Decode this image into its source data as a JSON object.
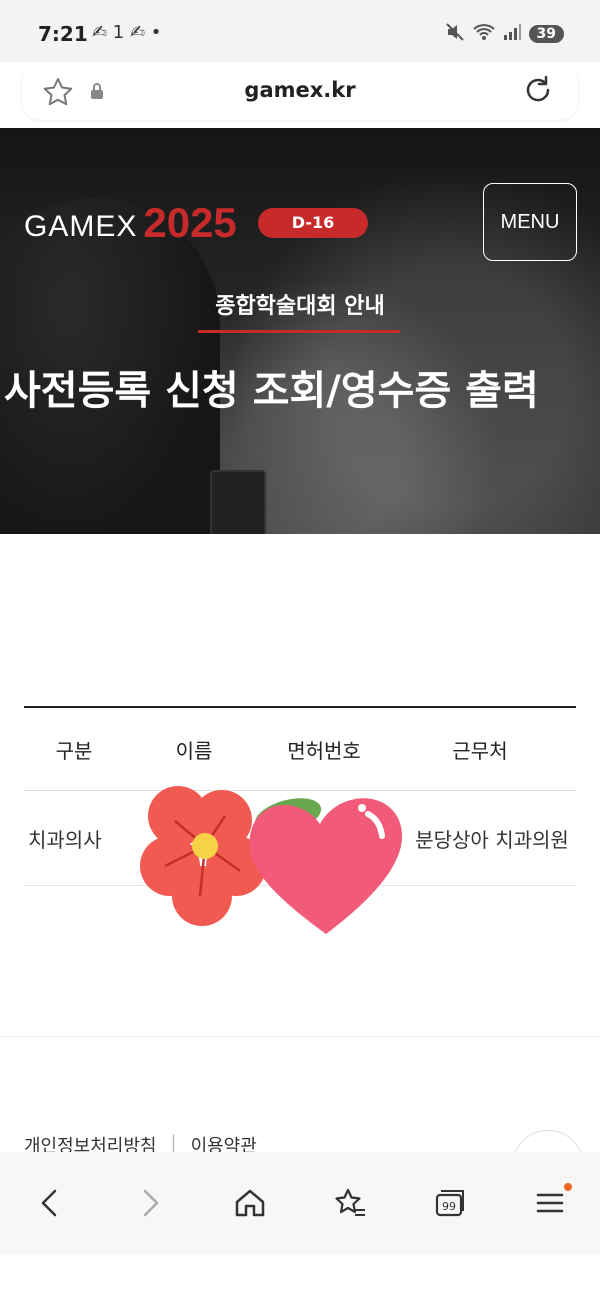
{
  "status_bar": {
    "time": "7:21",
    "left_icons": "✍ 1 ✍ •",
    "battery": "39"
  },
  "browser": {
    "url": "gamex.kr"
  },
  "hero": {
    "logo_text": "GAMEX",
    "logo_year": "2025",
    "dday": "D-16",
    "menu_label": "MENU",
    "subtitle": "종합학술대회 안내",
    "page_title": "사전등록 신청 조회/영수증 출력"
  },
  "table": {
    "headers": [
      "구분",
      "이름",
      "면허번호",
      "근무처"
    ],
    "rows": [
      [
        "치과의사",
        "",
        "",
        "분당상아 치과의원"
      ]
    ]
  },
  "footer": {
    "privacy_label": "개인정보처리방침",
    "terms_label": "이용약관"
  },
  "colors": {
    "brand_red": "#c62a2a",
    "notif_dot": "#f26522"
  }
}
